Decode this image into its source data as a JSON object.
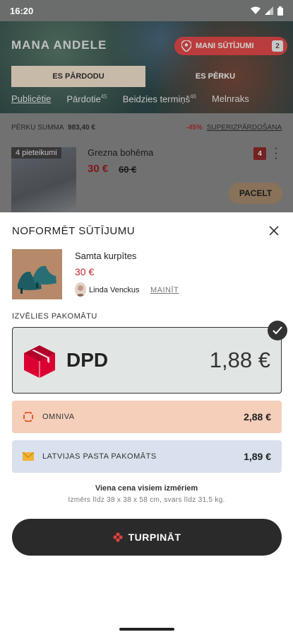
{
  "status_bar": {
    "time": "16:20"
  },
  "background": {
    "brand": "MANA ANDELE",
    "my_orders": {
      "label": "MANI SŪTĪJUMI",
      "count": "2"
    },
    "segments": {
      "sell": "ES PĀRDODU",
      "buy": "ES PĒRKU"
    },
    "tabs": [
      {
        "label": "Publicētie",
        "sup": ""
      },
      {
        "label": "Pārdotie",
        "sup": "45"
      },
      {
        "label": "Beidzies termiņš",
        "sup": "46"
      },
      {
        "label": "Melnraks",
        "sup": ""
      }
    ],
    "summary": {
      "label": "PĒRKU SUMMA",
      "amount": "983,40 €",
      "percent": "-45%",
      "link": "SUPERIZPĀRDOŠANA"
    },
    "listing": {
      "badge": "4 pieteikumi",
      "title": "Grezna bohēma",
      "price": "30 €",
      "old_price": "60 €",
      "count": "4",
      "button": "PACELT"
    }
  },
  "sheet": {
    "title": "NOFORMĒT SŪTĪJUMU",
    "product": {
      "title": "Samta kurpītes",
      "price": "30 €",
      "seller": "Linda Venckus",
      "change_label": "MAINĪT"
    },
    "section_label": "IZVĒLIES PAKOMĀTU",
    "options": [
      {
        "name": "DPD",
        "price": "1,88 €",
        "selected": true,
        "color": "#e1e6e5",
        "icon": "dpd-logo"
      },
      {
        "name": "OMNIVA",
        "price": "2,88 €",
        "selected": false,
        "color": "#f6cfbb",
        "icon": "omniva-icon"
      },
      {
        "name": "LATVIJAS PASTA PAKOMĀTS",
        "price": "1,89 €",
        "selected": false,
        "color": "#d8e1ed",
        "icon": "envelope-icon"
      }
    ],
    "note_title": "Viena cena visiem izmēriem",
    "note_detail": "Izmērs līdz 38 x 38 x 58 cm, svars līdz 31,5 kg.",
    "continue_label": "TURPINĀT"
  },
  "colors": {
    "accent_red": "#c0262b",
    "dark": "#2a2a2a",
    "dpd_red": "#dc0032"
  }
}
